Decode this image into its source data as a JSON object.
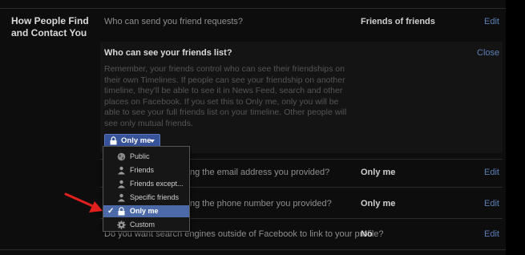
{
  "section": {
    "title": "How People Find and Contact You"
  },
  "rows": [
    {
      "question": "Who can send you friend requests?",
      "value": "Friends of friends",
      "edit": "Edit"
    },
    {
      "question": "Who can look you up using the email address you provided?",
      "visible_question": "ng the email address you provided?",
      "value": "Only me",
      "edit": "Edit"
    },
    {
      "question": "Who can look you up using the phone number you provided?",
      "visible_question": "ng the phone number you provided?",
      "value": "Only me",
      "edit": "Edit"
    },
    {
      "question": "Do you want search engines outside of Facebook to link to your profile?",
      "value": "No",
      "edit": "Edit"
    }
  ],
  "expanded": {
    "title": "Who can see your friends list?",
    "close": "Close",
    "description": "Remember, your friends control who can see their friendships on their own Timelines. If people can see your friendship on another timeline, they'll be able to see it in News Feed, search and other places on Facebook. If you set this to Only me, only you will be able to see your full friends list on your timeline. Other people will see only mutual friends."
  },
  "audience_button": {
    "label": "Only me",
    "icon": "lock-icon"
  },
  "audience_menu": {
    "items": [
      {
        "label": "Public",
        "icon": "globe-icon",
        "selected": false
      },
      {
        "label": "Friends",
        "icon": "friends-icon",
        "selected": false
      },
      {
        "label": "Friends except...",
        "icon": "friends-except-icon",
        "selected": false
      },
      {
        "label": "Specific friends",
        "icon": "specific-friends-icon",
        "selected": false
      },
      {
        "label": "Only me",
        "icon": "lock-icon",
        "selected": true
      },
      {
        "label": "Custom",
        "icon": "gear-icon",
        "selected": false
      }
    ]
  },
  "colors": {
    "link": "#5b7fb8",
    "selected": "#4d6aa8",
    "button": "#37539a",
    "annotation_arrow": "#e0201c"
  }
}
